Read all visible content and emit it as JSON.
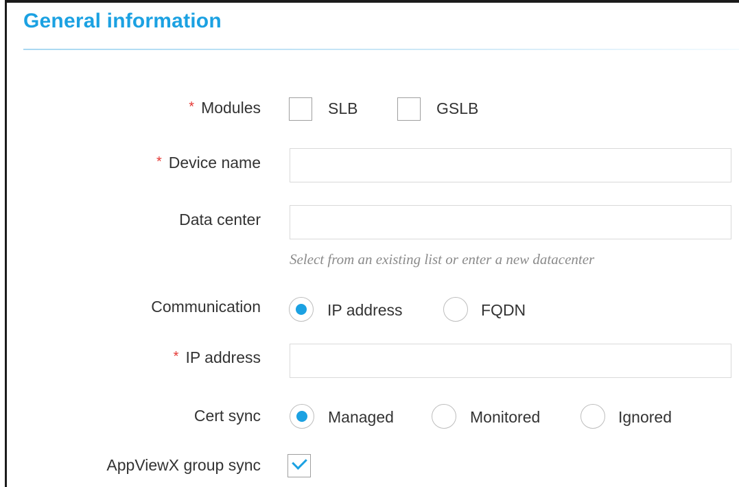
{
  "section": {
    "title": "General information"
  },
  "colors": {
    "accent": "#1ba1e2",
    "required": "#e53935",
    "text": "#333333"
  },
  "fields": {
    "modules": {
      "required": "*",
      "label": "Modules",
      "options": [
        {
          "label": "SLB",
          "checked": false
        },
        {
          "label": "GSLB",
          "checked": false
        }
      ]
    },
    "device_name": {
      "required": "*",
      "label": "Device name",
      "value": ""
    },
    "data_center": {
      "label": "Data center",
      "value": "",
      "hint": "Select from an existing list or enter a new datacenter"
    },
    "communication": {
      "label": "Communication",
      "options": [
        {
          "label": "IP address",
          "selected": true
        },
        {
          "label": "FQDN",
          "selected": false
        }
      ]
    },
    "ip_address": {
      "required": "*",
      "label": "IP address",
      "value": ""
    },
    "cert_sync": {
      "label": "Cert sync",
      "options": [
        {
          "label": "Managed",
          "selected": true
        },
        {
          "label": "Monitored",
          "selected": false
        },
        {
          "label": "Ignored",
          "selected": false
        }
      ]
    },
    "appviewx_group_sync": {
      "label": "AppViewX group sync",
      "checked": true
    }
  }
}
